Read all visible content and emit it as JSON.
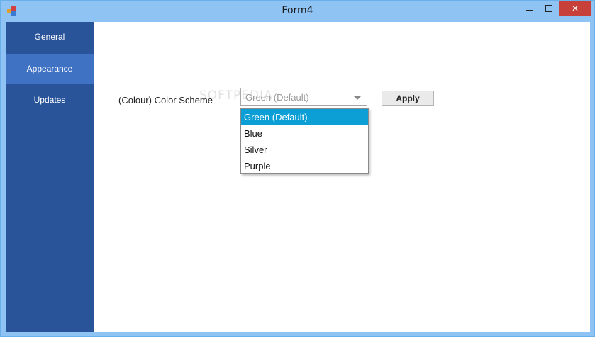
{
  "window": {
    "title": "Form4",
    "close_glyph": "✕"
  },
  "sidebar": {
    "items": [
      {
        "label": "General"
      },
      {
        "label": "Appearance",
        "active": true
      },
      {
        "label": "Updates"
      }
    ]
  },
  "appearance": {
    "color_scheme_label": "(Colour) Color Scheme",
    "combo_value": "Green (Default)",
    "apply_label": "Apply",
    "options": [
      {
        "label": "Green (Default)",
        "selected": true
      },
      {
        "label": "Blue"
      },
      {
        "label": "Silver"
      },
      {
        "label": "Purple"
      }
    ]
  },
  "watermark": "SOFTPEDIA",
  "colors": {
    "titlebar": "#8ec3f3",
    "sidebar": "#29549a",
    "sidebar_active": "#4072c4",
    "selected_option": "#0b9fd6",
    "close_button": "#c7403a"
  },
  "icons": {
    "app": "app-icon",
    "minimize": "minimize-icon",
    "maximize": "maximize-icon",
    "close": "close-icon",
    "dropdown": "chevron-down-icon"
  }
}
